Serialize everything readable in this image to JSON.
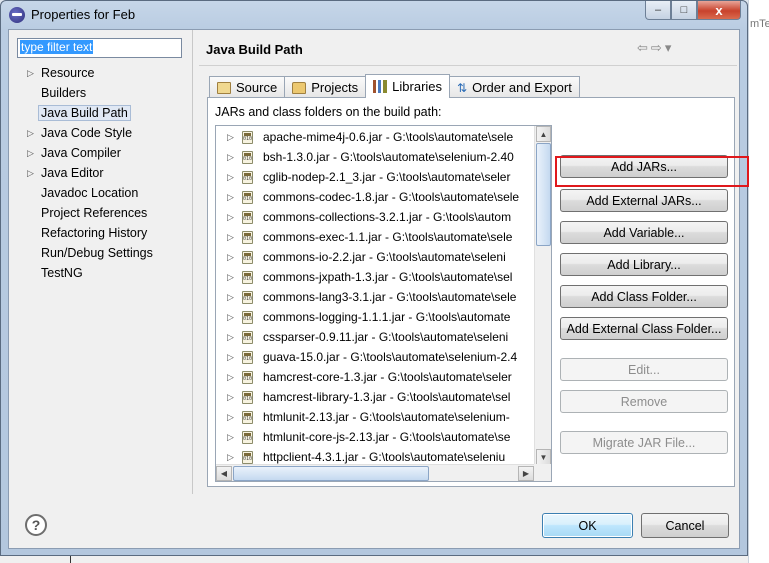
{
  "window": {
    "title": "Properties for Feb",
    "controls": {
      "minimize": "–",
      "maximize": "□",
      "close": "x"
    }
  },
  "background": {
    "text": "mTe"
  },
  "sidebar": {
    "filter_value": "type filter text",
    "items": [
      {
        "label": "Resource",
        "expandable": true
      },
      {
        "label": "Builders",
        "expandable": false
      },
      {
        "label": "Java Build Path",
        "expandable": false,
        "selected": true
      },
      {
        "label": "Java Code Style",
        "expandable": true
      },
      {
        "label": "Java Compiler",
        "expandable": true
      },
      {
        "label": "Java Editor",
        "expandable": true
      },
      {
        "label": "Javadoc Location",
        "expandable": false
      },
      {
        "label": "Project References",
        "expandable": false
      },
      {
        "label": "Refactoring History",
        "expandable": false
      },
      {
        "label": "Run/Debug Settings",
        "expandable": false
      },
      {
        "label": "TestNG",
        "expandable": false
      }
    ]
  },
  "page": {
    "title": "Java Build Path",
    "nav": {
      "back": "⇦",
      "forward": "⇨",
      "menu": "▾"
    },
    "tabs": [
      {
        "label": "Source",
        "icon": "source-folder-icon"
      },
      {
        "label": "Projects",
        "icon": "project-icon"
      },
      {
        "label": "Libraries",
        "icon": "library-icon",
        "active": true
      },
      {
        "label": "Order and Export",
        "icon": "order-export-icon"
      }
    ],
    "panel_label": "JARs and class folders on the build path:",
    "jars": [
      "apache-mime4j-0.6.jar - G:\\tools\\automate\\sele",
      "bsh-1.3.0.jar - G:\\tools\\automate\\selenium-2.40",
      "cglib-nodep-2.1_3.jar - G:\\tools\\automate\\seler",
      "commons-codec-1.8.jar - G:\\tools\\automate\\sele",
      "commons-collections-3.2.1.jar - G:\\tools\\autom",
      "commons-exec-1.1.jar - G:\\tools\\automate\\sele",
      "commons-io-2.2.jar - G:\\tools\\automate\\seleni",
      "commons-jxpath-1.3.jar - G:\\tools\\automate\\sel",
      "commons-lang3-3.1.jar - G:\\tools\\automate\\sele",
      "commons-logging-1.1.1.jar - G:\\tools\\automate",
      "cssparser-0.9.11.jar - G:\\tools\\automate\\seleni",
      "guava-15.0.jar - G:\\tools\\automate\\selenium-2.4",
      "hamcrest-core-1.3.jar - G:\\tools\\automate\\seler",
      "hamcrest-library-1.3.jar - G:\\tools\\automate\\sel",
      "htmlunit-2.13.jar - G:\\tools\\automate\\selenium-",
      "htmlunit-core-js-2.13.jar - G:\\tools\\automate\\se",
      "httpclient-4.3.1.jar - G:\\tools\\automate\\seleniu"
    ],
    "buttons": {
      "add_jars": "Add JARs...",
      "add_external_jars": "Add External JARs...",
      "add_variable": "Add Variable...",
      "add_library": "Add Library...",
      "add_class_folder": "Add Class Folder...",
      "add_external_class_folder": "Add External Class Folder...",
      "edit": "Edit...",
      "remove": "Remove",
      "migrate_jar": "Migrate JAR File..."
    }
  },
  "footer": {
    "help": "?",
    "ok": "OK",
    "cancel": "Cancel"
  },
  "colors": {
    "highlight_box": "#e0181c",
    "selection": "#3399ff"
  }
}
